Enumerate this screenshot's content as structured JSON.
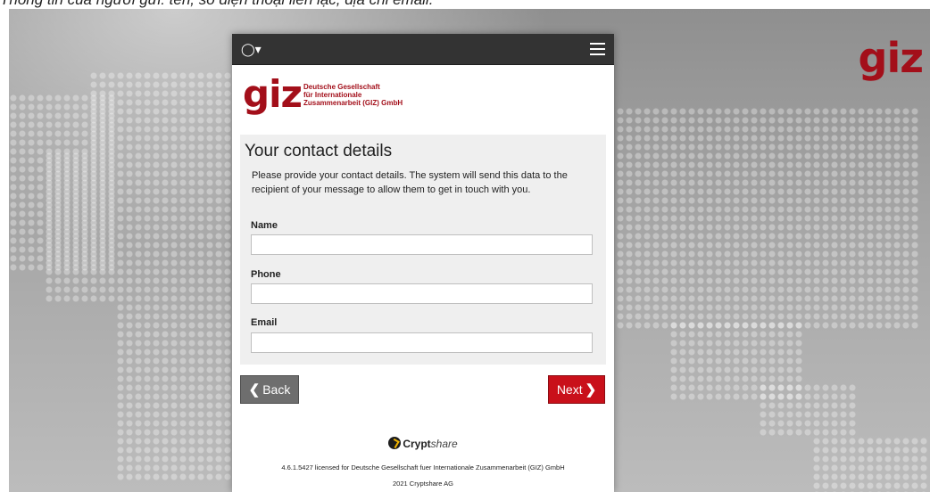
{
  "caption": "Thông tin của người gửi: tên, số điện thoại liên lạc, địa chỉ email.",
  "background": {
    "logo_text": "giz"
  },
  "topbar": {
    "language_icon": "globe-icon",
    "menu_icon": "hamburger-menu-icon"
  },
  "brand": {
    "mark": "giz",
    "line1": "Deutsche Gesellschaft",
    "line2": "für Internationale",
    "line3": "Zusammenarbeit (GIZ) GmbH"
  },
  "form": {
    "title": "Your contact details",
    "intro": "Please provide your contact details. The system will send this data to the recipient of your message to allow them to get in touch with you.",
    "name_label": "Name",
    "name_value": "",
    "phone_label": "Phone",
    "phone_value": "",
    "email_label": "Email",
    "email_value": ""
  },
  "buttons": {
    "back": "Back",
    "next": "Next"
  },
  "footer": {
    "brand_bold": "Crypt",
    "brand_italic": "share",
    "license": "4.6.1.5427 licensed for Deutsche Gesellschaft fuer Internationale Zusammenarbeit (GIZ) GmbH",
    "copyright": "2021 Cryptshare AG"
  },
  "colors": {
    "brand_red": "#a30f1a",
    "next_button": "#c9101a",
    "back_button": "#6e6e6e",
    "topbar": "#333333"
  }
}
